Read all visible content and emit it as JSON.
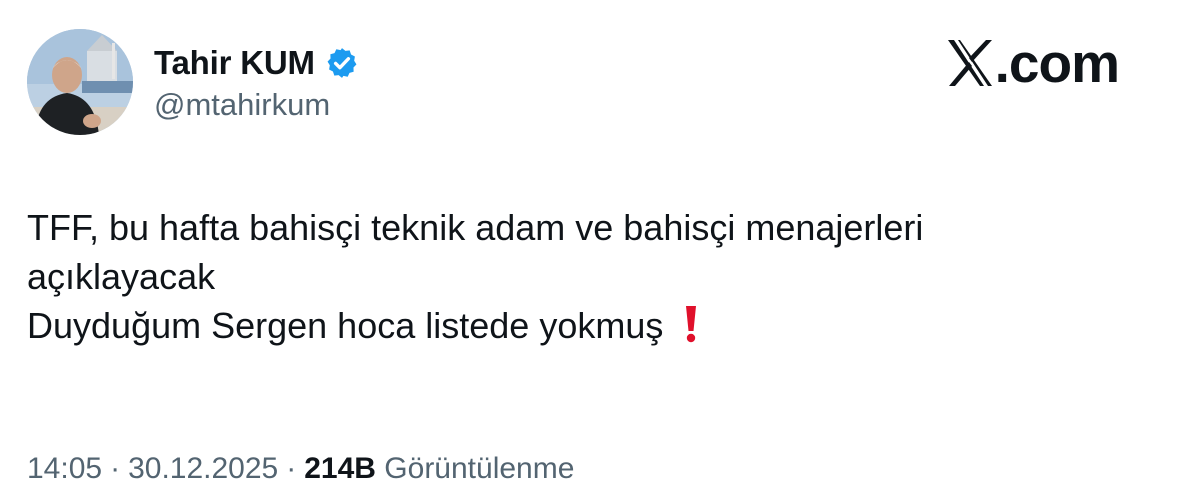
{
  "author": {
    "display_name": "Tahir KUM",
    "handle": "@mtahirkum",
    "verified": true,
    "verified_color": "#1d9bf0"
  },
  "brand": {
    "text": ".com",
    "icon": "x-logo-icon"
  },
  "tweet": {
    "lines": [
      "TFF, bu hafta bahisçi teknik adam ve bahisçi menajerleri",
      "açıklayacak",
      "Duyduğum Sergen hoca listede yokmuş"
    ],
    "emoji": "exclamation-mark-icon",
    "emoji_color": "#e0102b"
  },
  "meta": {
    "time": "14:05",
    "separator": "·",
    "date": "30.12.2025",
    "views_count": "214B",
    "views_label": "Görüntülenme"
  }
}
